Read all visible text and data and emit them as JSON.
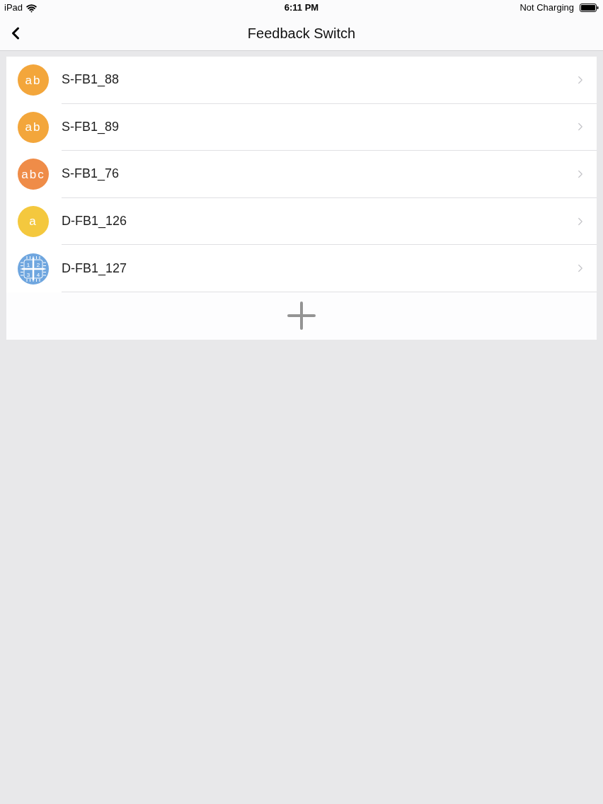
{
  "status_bar": {
    "device": "iPad",
    "time": "6:11 PM",
    "battery_status": "Not Charging"
  },
  "nav_bar": {
    "title": "Feedback Switch"
  },
  "items": [
    {
      "name": "S-FB1_88",
      "icon": {
        "kind": "letters",
        "text": "ab",
        "color": "#f3a63b"
      }
    },
    {
      "name": "S-FB1_89",
      "icon": {
        "kind": "letters",
        "text": "ab",
        "color": "#f3a63b"
      }
    },
    {
      "name": "S-FB1_76",
      "icon": {
        "kind": "letters",
        "text": "abc",
        "color": "#ef8c48"
      }
    },
    {
      "name": "D-FB1_126",
      "icon": {
        "kind": "letters",
        "text": "a",
        "color": "#f4c83e"
      }
    },
    {
      "name": "D-FB1_127",
      "icon": {
        "kind": "grid",
        "digits": [
          "1",
          "2",
          "3",
          "4"
        ],
        "color": "#6fa6df"
      }
    }
  ]
}
